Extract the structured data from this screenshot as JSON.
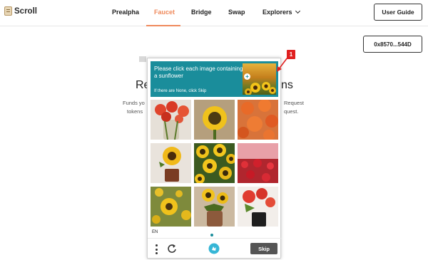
{
  "brand": {
    "name": "Scroll"
  },
  "nav": {
    "items": [
      {
        "label": "Prealpha",
        "active": false
      },
      {
        "label": "Faucet",
        "active": true
      },
      {
        "label": "Bridge",
        "active": false
      },
      {
        "label": "Swap",
        "active": false
      },
      {
        "label": "Explorers",
        "active": false
      }
    ]
  },
  "header": {
    "user_guide": "User Guide",
    "wallet": "0x8570...544D"
  },
  "page": {
    "title_left": "Re",
    "title_right": "ns",
    "line1_left": "Funds yo",
    "line1_right": "Request",
    "line2_left": "tokens",
    "line2_right": "quest."
  },
  "captcha": {
    "prompt": "Please click each image containing a sunflower",
    "sub": "If there are None, click Skip",
    "lang": "EN",
    "skip_label": "Skip",
    "tiles": [
      "red-tulips-vase",
      "sunflower",
      "orange-flowers",
      "potted-sunflower",
      "sunflower-field",
      "red-flower-field",
      "sunflower-field-2",
      "sunflower-pot",
      "red-tulip-pot"
    ]
  },
  "annotation": {
    "badge": "1"
  },
  "colors": {
    "accent": "#ef8a5c",
    "captcha_teal": "#1a8d9b",
    "badge_red": "#e02020",
    "skip_gray": "#555555"
  },
  "icons": [
    "scroll-logo-icon",
    "chevron-down-icon",
    "plus-icon",
    "menu-icon",
    "refresh-icon",
    "hcaptcha-logo-icon",
    "arrow-icon"
  ]
}
